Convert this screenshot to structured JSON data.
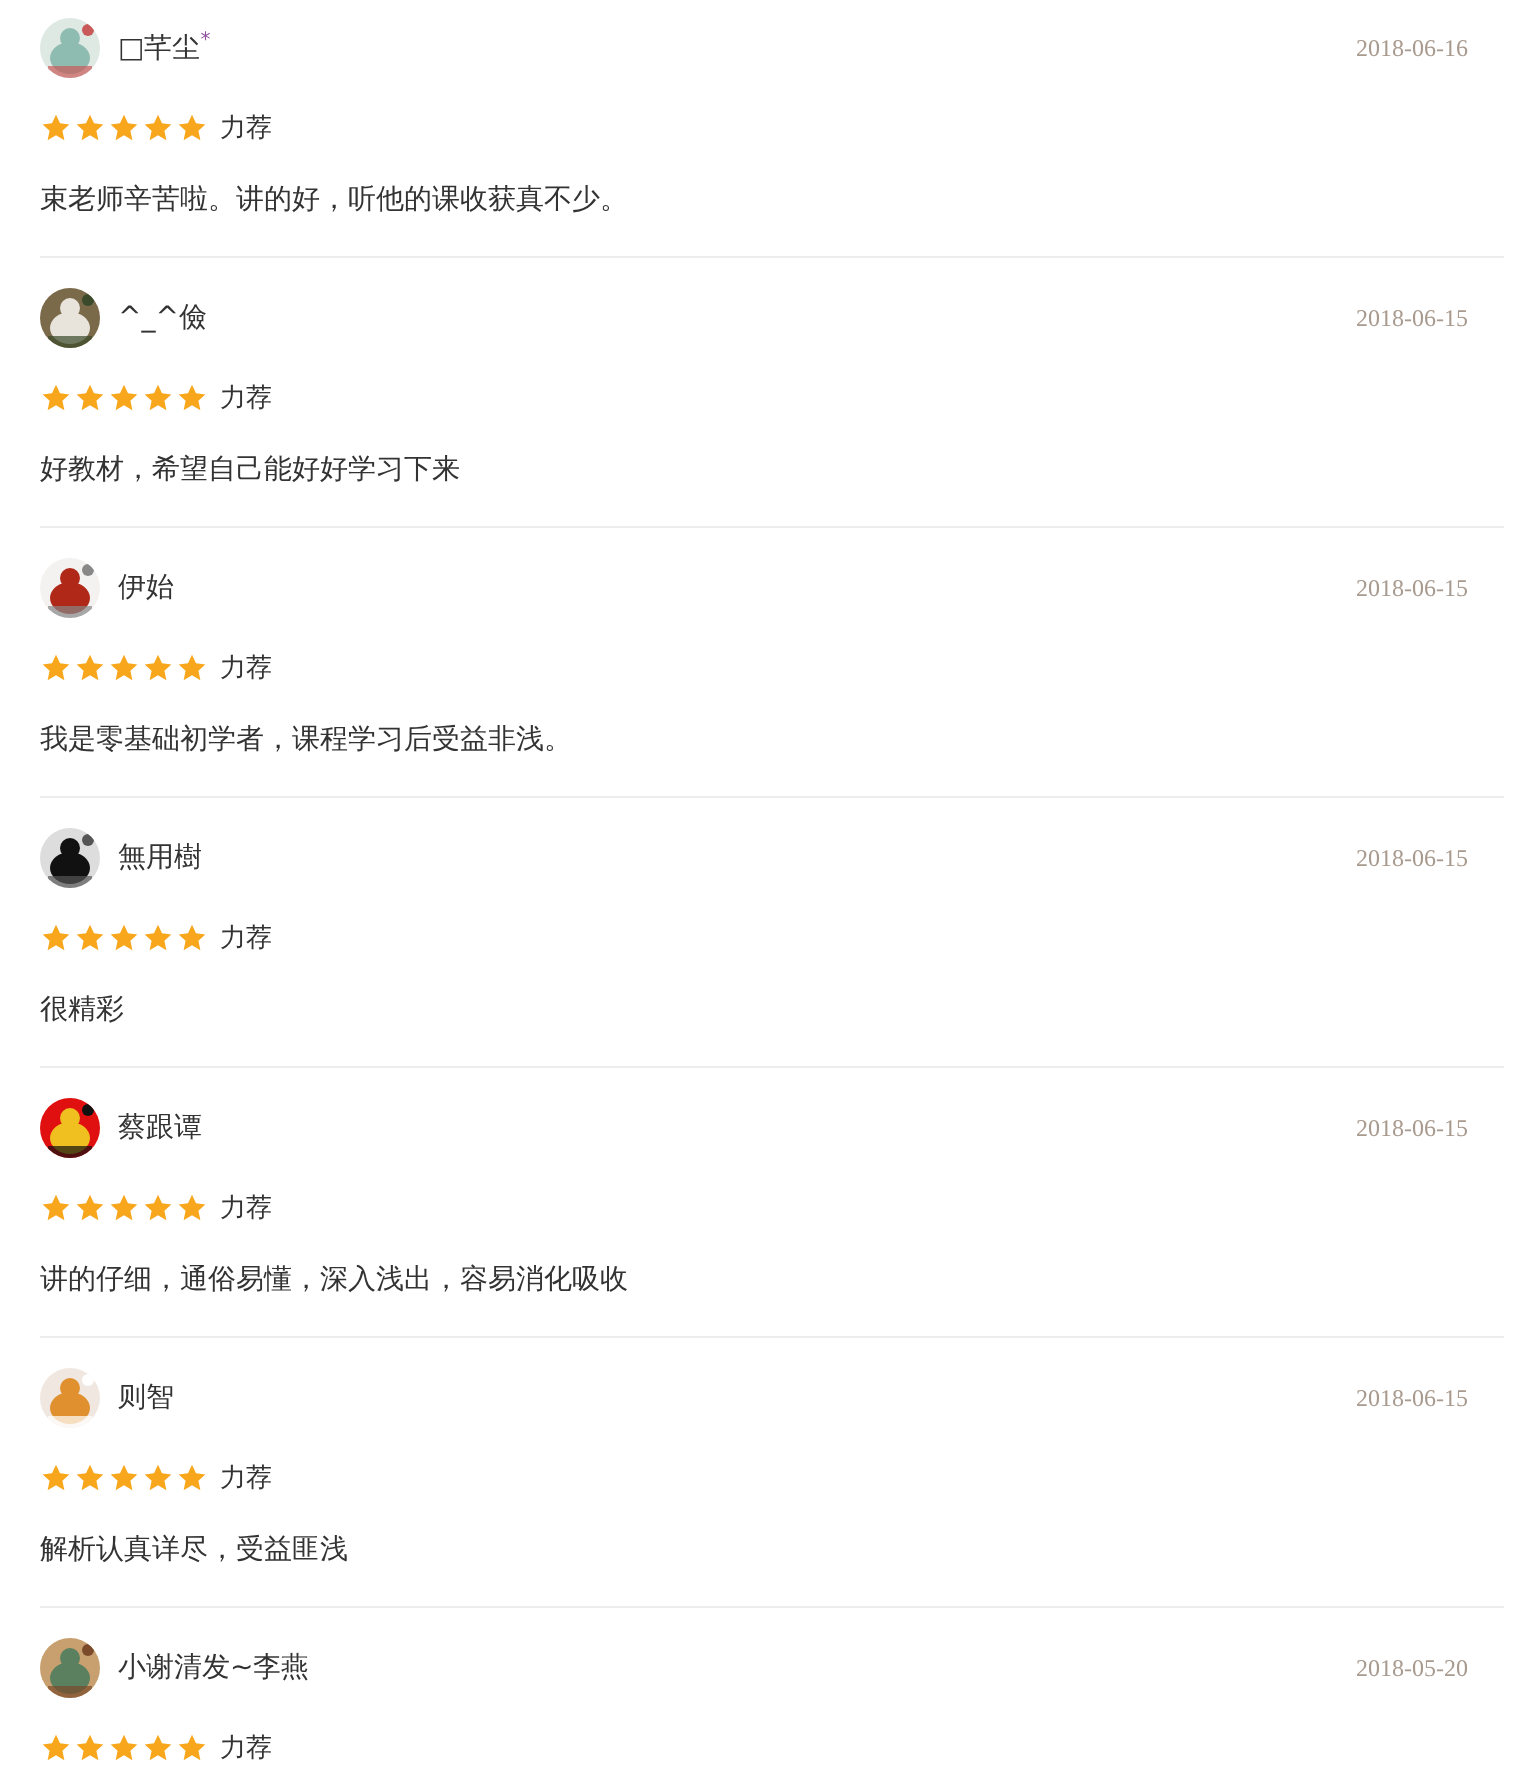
{
  "reviews": [
    {
      "user": "□芊尘$^{*}$",
      "date": "2018-06-16",
      "stars": 5,
      "rating_label": "力荐",
      "comment": "束老师辛苦啦。讲的好，听他的课收获真不少。"
    },
    {
      "user": "^_^儉",
      "date": "2018-06-15",
      "stars": 5,
      "rating_label": "力荐",
      "comment": "好教材，希望自己能好好学习下来"
    },
    {
      "user": "伊始",
      "date": "2018-06-15",
      "stars": 5,
      "rating_label": "力荐",
      "comment": "我是零基础初学者，课程学习后受益非浅。"
    },
    {
      "user": "無用樹",
      "date": "2018-06-15",
      "stars": 5,
      "rating_label": "力荐",
      "comment": "很精彩"
    },
    {
      "user": "蔡跟谭",
      "date": "2018-06-15",
      "stars": 5,
      "rating_label": "力荐",
      "comment": "讲的仔细，通俗易懂，深入浅出，容易消化吸收"
    },
    {
      "user": "则智",
      "date": "2018-06-15",
      "stars": 5,
      "rating_label": "力荐",
      "comment": "解析认真详尽，受益匪浅"
    },
    {
      "user": "小谢清发~李燕",
      "date": "2018-05-20",
      "stars": 5,
      "rating_label": "力荐"
    }
  ]
}
